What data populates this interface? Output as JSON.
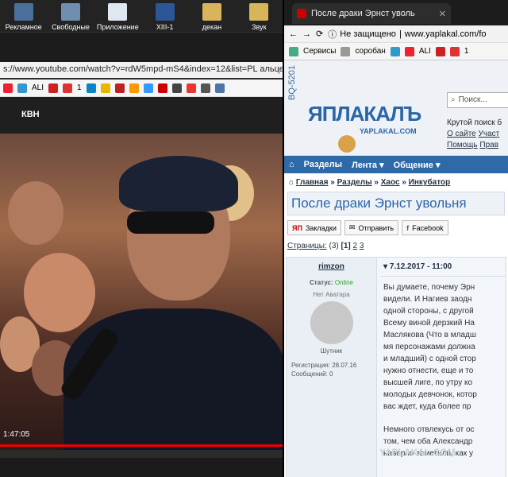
{
  "desktop": {
    "icons": [
      {
        "label": "Рекламное",
        "color": "#4a6f9a"
      },
      {
        "label": "Свободные",
        "color": "#6f8fb0"
      },
      {
        "label": "Приложение",
        "color": "#dfe7f1"
      },
      {
        "label": "XIII-1",
        "color": "#2b5797"
      },
      {
        "label": "декан",
        "color": "#d8b45a"
      },
      {
        "label": "Звук",
        "color": "#d8b45a"
      }
    ]
  },
  "left_browser": {
    "url": "s://www.youtube.com/watch?v=rdW5mpd-mS4&index=12&list=PL",
    "url_overlay": "альцев",
    "bookmarks": [
      "ALI",
      "1"
    ],
    "channel": "КВН",
    "video_time": "1:47:05"
  },
  "right_browser": {
    "tab_title": "После драки Эрнст уволь",
    "security": "Не защищено",
    "url": "www.yaplakal.com/fo",
    "bookmarks": [
      "Сервисы",
      "соробан",
      "ALI",
      "1"
    ]
  },
  "site": {
    "vertical_text": "BQ-5201",
    "logo": "ЯПЛАКАЛЪ",
    "logo_sub": "YAPLAKAL.COM",
    "search_placeholder": "Поиск...",
    "side_links": [
      "Крутой поиск б",
      "О сайте",
      "Участ",
      "Помощь",
      "Прав"
    ],
    "menu": [
      "Разделы",
      "Лента ▾",
      "Общение ▾"
    ],
    "breadcrumbs": [
      "Главная",
      "Разделы",
      "Хаос",
      "Инкубатор"
    ],
    "title": "После драки Эрнст увольня",
    "share": [
      "Закладки",
      "Отправить",
      "Facebook"
    ],
    "pages_label": "Страницы:",
    "pages_count": "(3)",
    "pages": [
      "[1]",
      "2",
      "3"
    ],
    "post": {
      "author": "rimzon",
      "status_label": "Статус:",
      "status": "Online",
      "no_avatar": "Нет Аватара",
      "rank": "Шутник",
      "registration": "Регистрация: 28.07.16",
      "messages": "Сообщений: 0",
      "date": "7.12.2017 - 11:00",
      "lines": [
        "Вы думаете, почему Эрн",
        "видели. И Нагиев заодн",
        "одной стороны, с другой",
        "Всему виной дерзкий На",
        "Маслякова (Что в младш",
        "мя персонажами должна",
        "и младший) с одной стор",
        "нужно отнести, еще и то",
        "высшей лиге, по утру ко",
        "молодых девчонок, котор",
        "вас ждет, куда более пр"
      ],
      "lines2": [
        "Немного отвлекусь от ос",
        "том, чем оба Александр",
        "наверно заметили, как у"
      ]
    },
    "watermark": "YAPLAKAL.COM"
  }
}
